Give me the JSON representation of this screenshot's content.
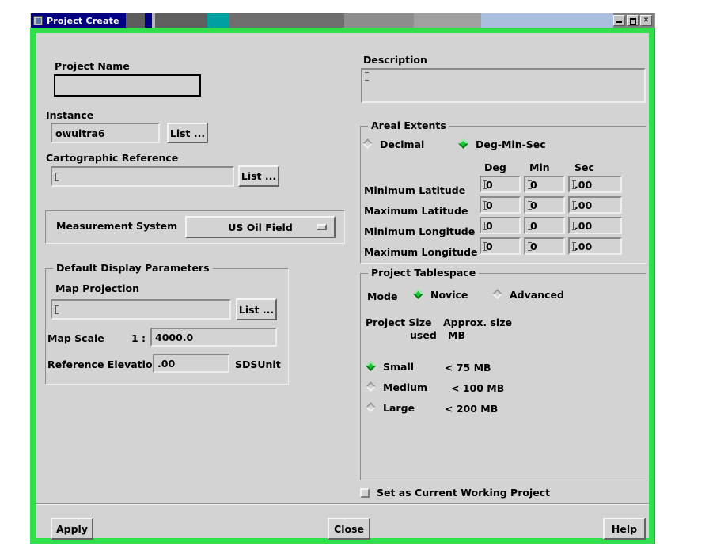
{
  "window": {
    "title": "Project Create",
    "icon": "window-menu-icon",
    "controls": {
      "minimize": "minimize-icon",
      "maximize": "maximize-icon",
      "close": "close-icon"
    },
    "titlebar_segments": [
      "#000080",
      "#5d5d5d",
      "#000080",
      "#6b6b6b",
      "#00a0a0",
      "#6e6e6e",
      "#8a8a8a",
      "#9c9c9c",
      "#aab9d4"
    ],
    "frame_color": "#2fe04a"
  },
  "left": {
    "project_name": {
      "label": "Project Name",
      "value": "",
      "placeholder": ""
    },
    "instance": {
      "label": "Instance",
      "value": "owultra6",
      "list_button": "List ..."
    },
    "cartographic_reference": {
      "label": "Cartographic Reference",
      "value": "",
      "list_button": "List ..."
    },
    "measurement_system": {
      "label": "Measurement System",
      "value": "US Oil Field"
    },
    "default_display": {
      "title": "Default Display Parameters",
      "map_projection": {
        "label": "Map Projection",
        "value": "",
        "list_button": "List ..."
      },
      "map_scale": {
        "label": "Map Scale",
        "prefix": "1 :",
        "value": "4000.0"
      },
      "reference_elevation": {
        "label": "Reference Elevation",
        "value": ".00",
        "unit": "SDSUnit"
      }
    }
  },
  "right": {
    "description": {
      "label": "Description",
      "value": "",
      "placeholder": ""
    },
    "areal_extents": {
      "title": "Areal Extents",
      "modes": [
        {
          "label": "Decimal",
          "selected": false
        },
        {
          "label": "Deg-Min-Sec",
          "selected": true
        }
      ],
      "columns": [
        "Deg",
        "Min",
        "Sec"
      ],
      "rows": [
        {
          "label": "Minimum Latitude",
          "deg": "0",
          "min": "0",
          "sec": ".00"
        },
        {
          "label": "Maximum Latitude",
          "deg": "0",
          "min": "0",
          "sec": ".00"
        },
        {
          "label": "Minimum Longitude",
          "deg": "0",
          "min": "0",
          "sec": ".00"
        },
        {
          "label": "Maximum Longitude",
          "deg": "0",
          "min": "0",
          "sec": ".00"
        }
      ]
    },
    "tablespace": {
      "title": "Project Tablespace",
      "mode_label": "Mode",
      "modes": [
        {
          "label": "Novice",
          "selected": true
        },
        {
          "label": "Advanced",
          "selected": false
        }
      ],
      "header_col1_line1": "Project Size",
      "header_col1_line2": "used",
      "header_col2_line1": "Approx. size",
      "header_col2_line2": "MB",
      "sizes": [
        {
          "label": "Small",
          "approx": "< 75 MB",
          "selected": true
        },
        {
          "label": "Medium",
          "approx": "< 100 MB",
          "selected": false
        },
        {
          "label": "Large",
          "approx": "< 200 MB",
          "selected": false
        }
      ]
    },
    "set_current": {
      "label": "Set as Current Working Project",
      "checked": false
    }
  },
  "actions": {
    "apply": "Apply",
    "close": "Close",
    "help": "Help"
  }
}
